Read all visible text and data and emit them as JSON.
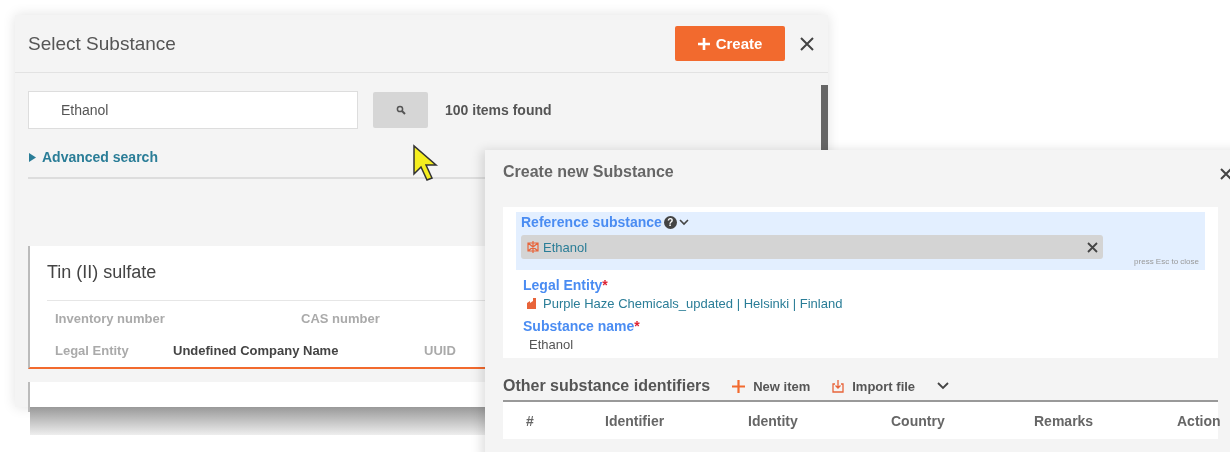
{
  "select_dialog": {
    "title": "Select Substance",
    "create_button": "Create",
    "search": {
      "value": "Ethanol"
    },
    "result_count": "100 items found",
    "advanced_search": {
      "label": "Advanced search",
      "expanded": false
    },
    "results": [
      {
        "name": "Tin (II) sulfate",
        "selected": true,
        "rows": [
          [
            {
              "label": "Inventory number"
            },
            {
              "label": "CAS number"
            }
          ],
          [
            {
              "label": "Legal Entity",
              "value": "Undefined Company Name"
            },
            {
              "label": "UUID"
            }
          ]
        ]
      }
    ]
  },
  "create_dialog": {
    "title": "Create new Substance",
    "reference_substance": {
      "label": "Reference substance",
      "help_glyph": "?",
      "value": "Ethanol",
      "hint": "press Esc to close"
    },
    "legal_entity": {
      "label": "Legal Entity",
      "required_mark": "*",
      "value": "Purple Haze Chemicals_updated | Helsinki | Finland"
    },
    "substance_name": {
      "label": "Substance name",
      "required_mark": "*",
      "value": "Ethanol"
    },
    "identifiers": {
      "title": "Other substance identifiers",
      "new_item": "New item",
      "import_file": "Import file",
      "columns": [
        "#",
        "Identifier",
        "Identity",
        "Country",
        "Remarks",
        "Action"
      ]
    }
  }
}
